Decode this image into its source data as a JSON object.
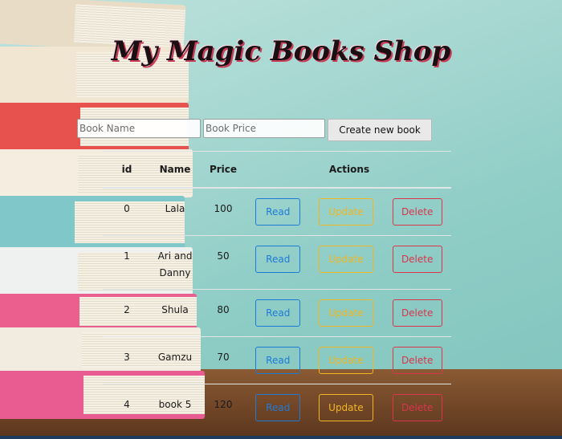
{
  "app": {
    "title": "My Magic Books Shop"
  },
  "form": {
    "name_placeholder": "Book Name",
    "price_placeholder": "Book Price",
    "create_label": "Create new book"
  },
  "table": {
    "headers": {
      "id": "id",
      "name": "Name",
      "price": "Price",
      "actions": "Actions"
    },
    "action_labels": {
      "read": "Read",
      "update": "Update",
      "delete": "Delete"
    },
    "rows": [
      {
        "id": "0",
        "name": "Lala",
        "price": "100"
      },
      {
        "id": "1",
        "name": "Ari and Danny",
        "price": "50"
      },
      {
        "id": "2",
        "name": "Shula",
        "price": "80"
      },
      {
        "id": "3",
        "name": "Gamzu",
        "price": "70"
      },
      {
        "id": "4",
        "name": "book 5",
        "price": "120"
      }
    ]
  },
  "colors": {
    "read": "#1f7ad6",
    "update": "#f0b623",
    "delete": "#d9354d",
    "title_shadow": "#c83c58"
  }
}
